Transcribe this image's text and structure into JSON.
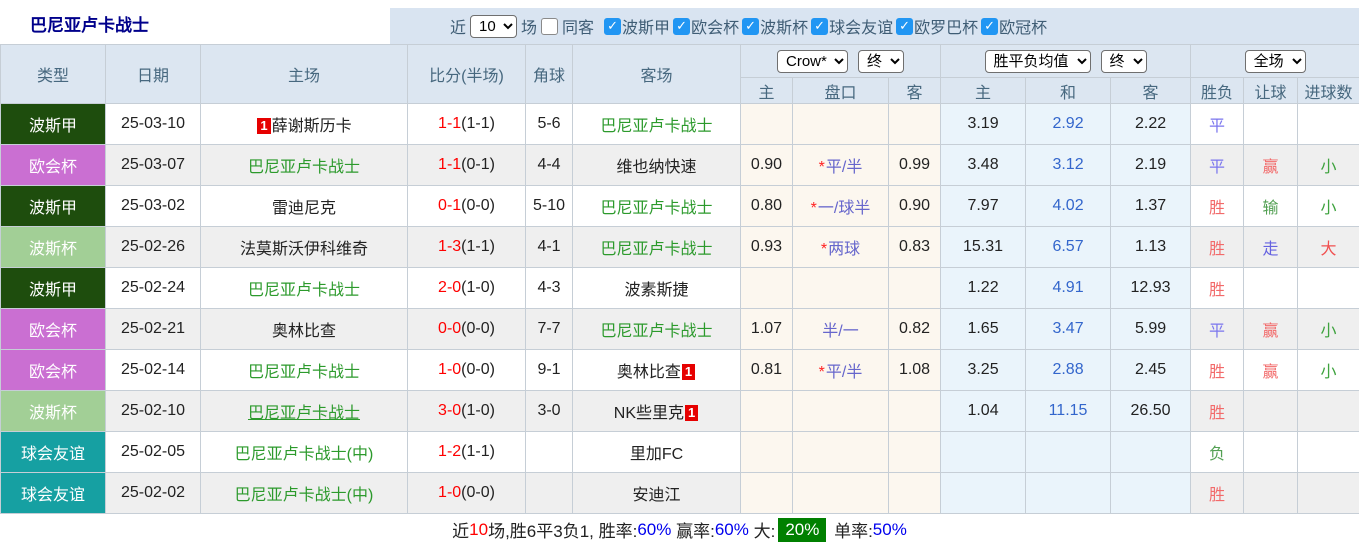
{
  "title": "巴尼亚卢卡战士",
  "controls": {
    "near_label": "近",
    "matches_select": "10",
    "matches_label": "场",
    "same_opponent_label": "同客",
    "same_opponent_checked": false,
    "league_filters": [
      {
        "label": "波斯甲",
        "checked": true
      },
      {
        "label": "欧会杯",
        "checked": true
      },
      {
        "label": "波斯杯",
        "checked": true
      },
      {
        "label": "球会友谊",
        "checked": true
      },
      {
        "label": "欧罗巴杯",
        "checked": true
      },
      {
        "label": "欧冠杯",
        "checked": true
      }
    ]
  },
  "colors": {
    "panel_blue": "#d9e4f1",
    "header_bg": "#dce6f1",
    "self_team_green": "#2c9a2c",
    "score_red": "#ff0000",
    "handicap_blue": "#6666cc",
    "star_red": "#ff2222",
    "avg_draw_blue": "#3366cc",
    "badge_red": "#e60000",
    "summary_blue": "#0000ee",
    "summary_green_bg": "#008000",
    "title_navy": "#00008b",
    "checkbox_blue": "#2196f3"
  },
  "league_colors": {
    "波斯甲": "#1e4d0d",
    "欧会杯": "#ca6fd2",
    "波斯杯": "#a2cf96",
    "球会友谊": "#16a0a2"
  },
  "outcome_colors": {
    "胜": "#f26a6a",
    "平": "#7b76ee",
    "负": "#53a053",
    "赢": "#f26a6a",
    "输": "#53a053",
    "走": "#6663e0",
    "大": "#f05050",
    "小": "#3fa33f"
  },
  "table": {
    "header": {
      "type": "类型",
      "date": "日期",
      "home": "主场",
      "score": "比分(半场)",
      "corner": "角球",
      "away": "客场",
      "selects": {
        "crow": "Crow*",
        "crow_state": "终",
        "avg": "胜平负均值",
        "avg_state": "终",
        "period": "全场"
      },
      "sub": {
        "crow_home": "主",
        "handicap": "盘口",
        "crow_away": "客",
        "avg_home": "主",
        "avg_draw": "和",
        "avg_away": "客",
        "result": "胜负",
        "handicap_result": "让球",
        "goals": "进球数"
      }
    },
    "rows": [
      {
        "league": "波斯甲",
        "date": "25-03-10",
        "home": "薛谢斯历卡",
        "home_badge": "1",
        "home_self": false,
        "home_underline": false,
        "score": "1-1",
        "half": "(1-1)",
        "corner": "5-6",
        "away": "巴尼亚卢卡战士",
        "away_badge": "",
        "away_self": true,
        "crow_home": "",
        "handicap": "",
        "handicap_star": false,
        "crow_away": "",
        "avg_home": "3.19",
        "avg_draw": "2.92",
        "avg_away": "2.22",
        "result": "平",
        "handicap_result": "",
        "goals": ""
      },
      {
        "league": "欧会杯",
        "date": "25-03-07",
        "home": "巴尼亚卢卡战士",
        "home_badge": "",
        "home_self": true,
        "home_underline": false,
        "score": "1-1",
        "half": "(0-1)",
        "corner": "4-4",
        "away": "维也纳快速",
        "away_badge": "",
        "away_self": false,
        "crow_home": "0.90",
        "handicap": "平/半",
        "handicap_star": true,
        "crow_away": "0.99",
        "avg_home": "3.48",
        "avg_draw": "3.12",
        "avg_away": "2.19",
        "result": "平",
        "handicap_result": "赢",
        "goals": "小"
      },
      {
        "league": "波斯甲",
        "date": "25-03-02",
        "home": "雷迪尼克",
        "home_badge": "",
        "home_self": false,
        "home_underline": false,
        "score": "0-1",
        "half": "(0-0)",
        "corner": "5-10",
        "away": "巴尼亚卢卡战士",
        "away_badge": "",
        "away_self": true,
        "crow_home": "0.80",
        "handicap": "一/球半",
        "handicap_star": true,
        "crow_away": "0.90",
        "avg_home": "7.97",
        "avg_draw": "4.02",
        "avg_away": "1.37",
        "result": "胜",
        "handicap_result": "输",
        "goals": "小"
      },
      {
        "league": "波斯杯",
        "date": "25-02-26",
        "home": "法莫斯沃伊科维奇",
        "home_badge": "",
        "home_self": false,
        "home_underline": false,
        "score": "1-3",
        "half": "(1-1)",
        "corner": "4-1",
        "away": "巴尼亚卢卡战士",
        "away_badge": "",
        "away_self": true,
        "crow_home": "0.93",
        "handicap": "两球",
        "handicap_star": true,
        "crow_away": "0.83",
        "avg_home": "15.31",
        "avg_draw": "6.57",
        "avg_away": "1.13",
        "result": "胜",
        "handicap_result": "走",
        "goals": "大"
      },
      {
        "league": "波斯甲",
        "date": "25-02-24",
        "home": "巴尼亚卢卡战士",
        "home_badge": "",
        "home_self": true,
        "home_underline": false,
        "score": "2-0",
        "half": "(1-0)",
        "corner": "4-3",
        "away": "波素斯捷",
        "away_badge": "",
        "away_self": false,
        "crow_home": "",
        "handicap": "",
        "handicap_star": false,
        "crow_away": "",
        "avg_home": "1.22",
        "avg_draw": "4.91",
        "avg_away": "12.93",
        "result": "胜",
        "handicap_result": "",
        "goals": ""
      },
      {
        "league": "欧会杯",
        "date": "25-02-21",
        "home": "奥林比查",
        "home_badge": "",
        "home_self": false,
        "home_underline": false,
        "score": "0-0",
        "half": "(0-0)",
        "corner": "7-7",
        "away": "巴尼亚卢卡战士",
        "away_badge": "",
        "away_self": true,
        "crow_home": "1.07",
        "handicap": "半/一",
        "handicap_star": false,
        "crow_away": "0.82",
        "avg_home": "1.65",
        "avg_draw": "3.47",
        "avg_away": "5.99",
        "result": "平",
        "handicap_result": "赢",
        "goals": "小"
      },
      {
        "league": "欧会杯",
        "date": "25-02-14",
        "home": "巴尼亚卢卡战士",
        "home_badge": "",
        "home_self": true,
        "home_underline": false,
        "score": "1-0",
        "half": "(0-0)",
        "corner": "9-1",
        "away": "奥林比查",
        "away_badge": "1",
        "away_self": false,
        "crow_home": "0.81",
        "handicap": "平/半",
        "handicap_star": true,
        "crow_away": "1.08",
        "avg_home": "3.25",
        "avg_draw": "2.88",
        "avg_away": "2.45",
        "result": "胜",
        "handicap_result": "赢",
        "goals": "小"
      },
      {
        "league": "波斯杯",
        "date": "25-02-10",
        "home": "巴尼亚卢卡战士",
        "home_badge": "",
        "home_self": true,
        "home_underline": true,
        "score": "3-0",
        "half": "(1-0)",
        "corner": "3-0",
        "away": "NK些里克",
        "away_badge": "1",
        "away_self": false,
        "crow_home": "",
        "handicap": "",
        "handicap_star": false,
        "crow_away": "",
        "avg_home": "1.04",
        "avg_draw": "11.15",
        "avg_away": "26.50",
        "result": "胜",
        "handicap_result": "",
        "goals": ""
      },
      {
        "league": "球会友谊",
        "date": "25-02-05",
        "home": "巴尼亚卢卡战士(中)",
        "home_badge": "",
        "home_self": true,
        "home_underline": false,
        "score": "1-2",
        "half": "(1-1)",
        "corner": "",
        "away": "里加FC",
        "away_badge": "",
        "away_self": false,
        "crow_home": "",
        "handicap": "",
        "handicap_star": false,
        "crow_away": "",
        "avg_home": "",
        "avg_draw": "",
        "avg_away": "",
        "result": "负",
        "handicap_result": "",
        "goals": ""
      },
      {
        "league": "球会友谊",
        "date": "25-02-02",
        "home": "巴尼亚卢卡战士(中)",
        "home_badge": "",
        "home_self": true,
        "home_underline": false,
        "score": "1-0",
        "half": "(0-0)",
        "corner": "",
        "away": "安迪江",
        "away_badge": "",
        "away_self": false,
        "crow_home": "",
        "handicap": "",
        "handicap_star": false,
        "crow_away": "",
        "avg_home": "",
        "avg_draw": "",
        "avg_away": "",
        "result": "胜",
        "handicap_result": "",
        "goals": ""
      }
    ]
  },
  "summary": {
    "near_label": "近",
    "match_count": "10",
    "record_text": "场,胜6平3负1, 胜率:",
    "win_rate": "60%",
    "odds_win_label": " 赢率:",
    "odds_win_rate": "60%",
    "big_label": " 大:",
    "big_rate": "20%",
    "single_label": " 单率:",
    "single_rate": "50%"
  }
}
